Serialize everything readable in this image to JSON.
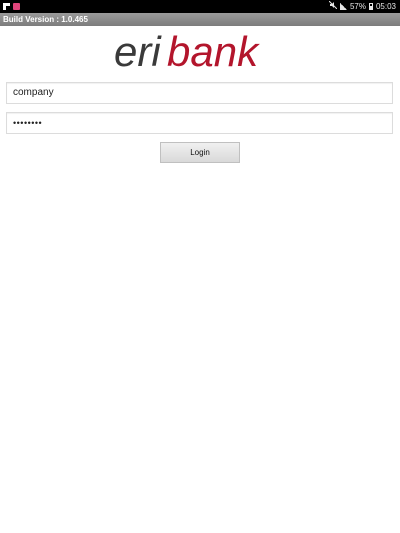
{
  "status_bar": {
    "time": "05:03",
    "battery": "57%",
    "icons": [
      "flipboard-icon",
      "notification-icon",
      "mute-icon",
      "signal-icon",
      "battery-icon"
    ]
  },
  "build_bar": {
    "text": "Build Version : 1.0.465"
  },
  "logo": {
    "part1": "eri",
    "part2": "bank",
    "color_part1": "#3a3a3a",
    "color_part2": "#b3152c"
  },
  "login_form": {
    "username_value": "company",
    "password_masked": "••••••••",
    "login_label": "Login"
  }
}
